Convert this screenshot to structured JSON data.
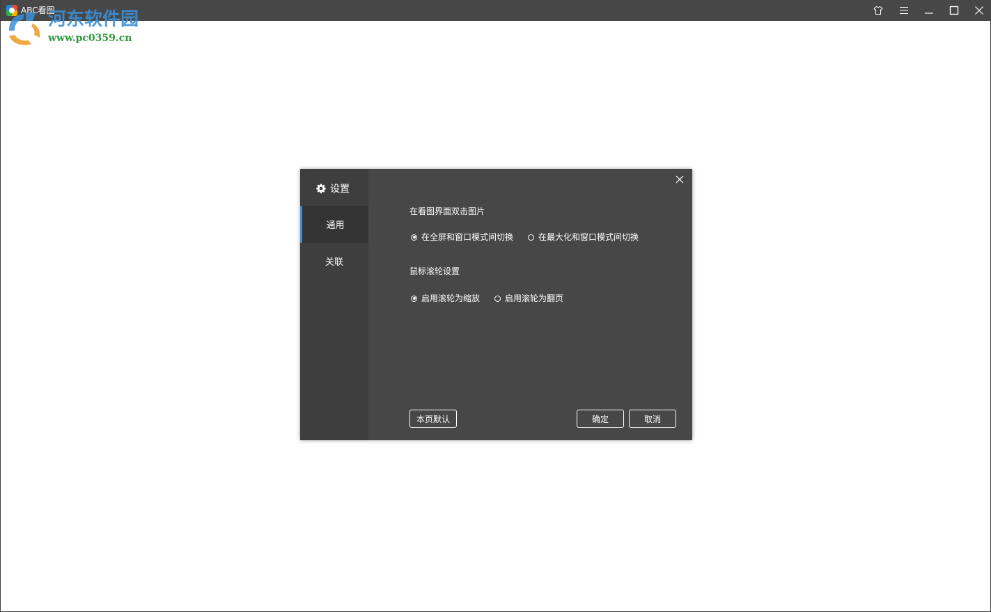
{
  "app": {
    "title": "ABC看图"
  },
  "watermark": {
    "text": "河东软件园",
    "url": "www.pc0359.cn"
  },
  "window_controls": {
    "icons": [
      "skin-icon",
      "menu-icon",
      "minimize-icon",
      "maximize-icon",
      "close-icon"
    ]
  },
  "dialog": {
    "title": "设置",
    "title_icon": "gear-icon",
    "nav": [
      {
        "label": "通用",
        "active": true
      },
      {
        "label": "关联",
        "active": false
      }
    ],
    "sections": [
      {
        "label": "在看图界面双击图片",
        "options": [
          {
            "label": "在全屏和窗口模式间切换",
            "checked": true
          },
          {
            "label": "在最大化和窗口模式间切换",
            "checked": false
          }
        ]
      },
      {
        "label": "鼠标滚轮设置",
        "options": [
          {
            "label": "启用滚轮为缩放",
            "checked": true
          },
          {
            "label": "启用滚轮为翻页",
            "checked": false
          }
        ]
      }
    ],
    "buttons": {
      "defaults": "本页默认",
      "ok": "确定",
      "cancel": "取消"
    }
  },
  "colors": {
    "titlebar": "#474747",
    "dialog_bg": "#474747",
    "sidebar_bg": "#3e3e3e",
    "active_item_bg": "#333333",
    "accent": "#3d8fd6"
  }
}
